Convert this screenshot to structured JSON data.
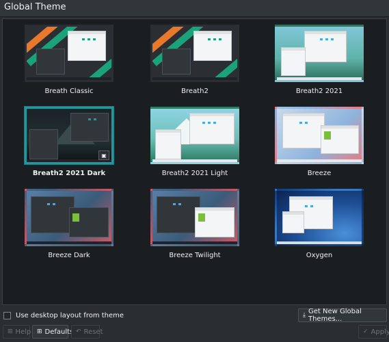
{
  "window": {
    "title": "Global Theme"
  },
  "themes": [
    {
      "name": "Breath Classic"
    },
    {
      "name": "Breath2"
    },
    {
      "name": "Breath2 2021"
    },
    {
      "name": "Breath2 2021 Dark",
      "selected": true
    },
    {
      "name": "Breath2 2021 Light"
    },
    {
      "name": "Breeze"
    },
    {
      "name": "Breeze Dark"
    },
    {
      "name": "Breeze Twilight"
    },
    {
      "name": "Oxygen"
    }
  ],
  "options": {
    "use_desktop_layout_label": "Use desktop layout from theme",
    "use_desktop_layout_checked": false
  },
  "buttons": {
    "get_new": "Get New Global Themes...",
    "help": "Help",
    "defaults": "Defaults",
    "reset": "Reset",
    "apply": "Apply"
  },
  "colors": {
    "accent": "#1d99a0",
    "background": "#2a2e32",
    "grid_background": "#1b1e20"
  },
  "icons": {
    "preview": "image-icon",
    "get_new": "download-icon",
    "help": "help-icon",
    "defaults": "defaults-icon",
    "reset": "undo-icon",
    "apply": "checkmark-icon"
  }
}
